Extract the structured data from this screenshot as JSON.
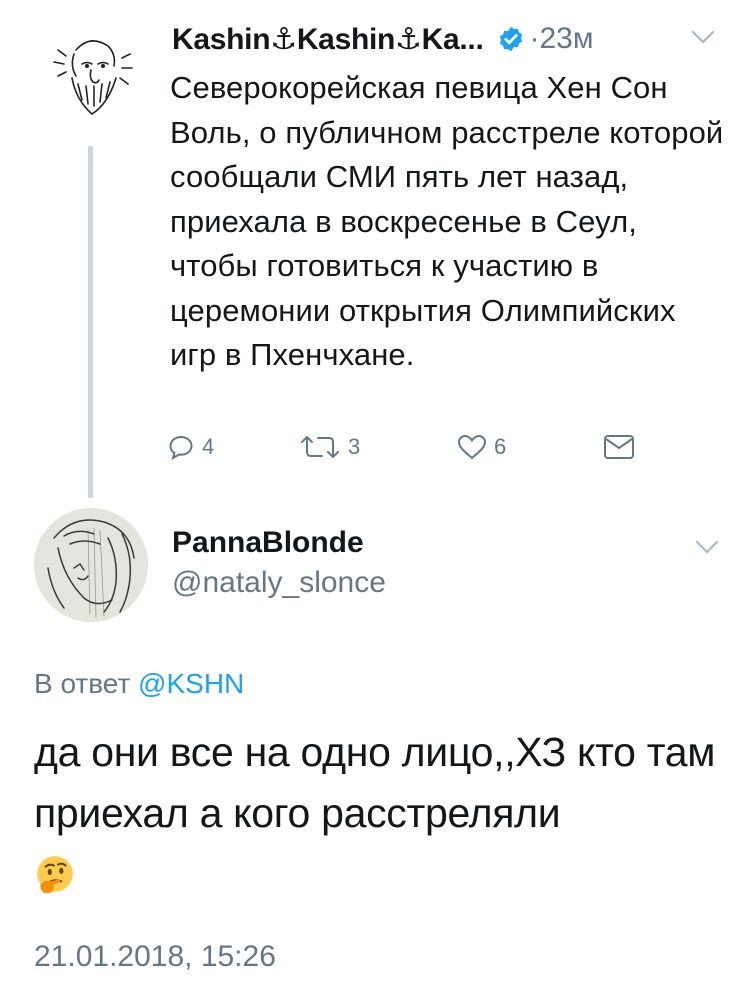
{
  "parent_tweet": {
    "display_name": "Kashin⚓Kashin⚓Ka...",
    "time": "23м",
    "text": "Северокорейская певица Хен Сон Воль, о публичном расстреле которой сообщали СМИ пять лет назад, приехала в воскресенье в Сеул, чтобы готовиться к участию в церемонии открытия Олимпийских игр в Пхенчхане.",
    "stats": {
      "replies": "4",
      "retweets": "3",
      "likes": "6"
    }
  },
  "reply_tweet": {
    "display_name": "PannaBlonde",
    "handle": "@nataly_slonce",
    "reply_to_prefix": "В ответ",
    "reply_to_handle": "@KSHN",
    "text": "да они все на одно лицо,,ХЗ кто там приехал а кого расстреляли",
    "emoji": "thinking-face",
    "timestamp": "21.01.2018, 15:26"
  },
  "colors": {
    "text": "#14171a",
    "secondary": "#657786",
    "link": "#1da1f2",
    "thread_line": "#ccd6dd",
    "verified": "#1da1f2"
  }
}
